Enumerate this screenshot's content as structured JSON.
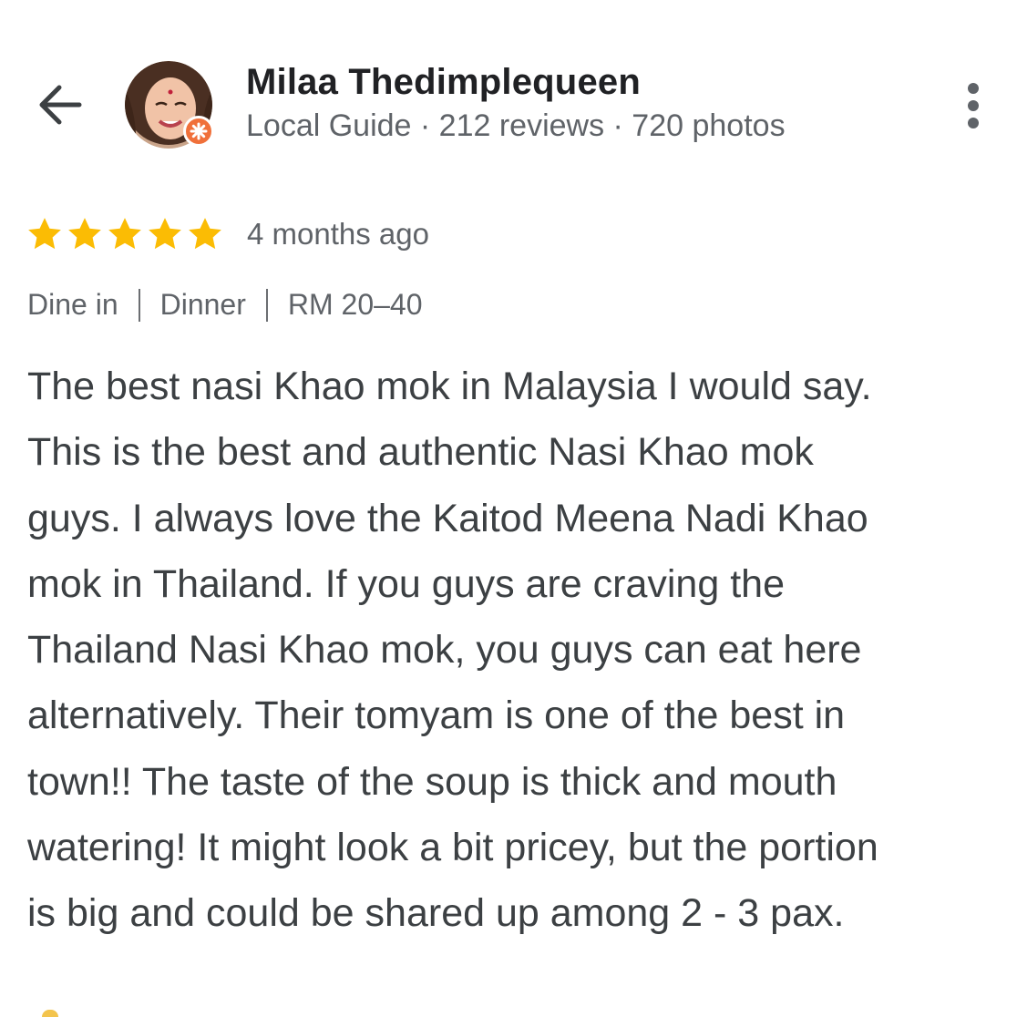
{
  "header": {
    "back_icon": "arrow-left-icon",
    "user_name": "Milaa Thedimplequeen",
    "user_meta": "Local Guide · 212 reviews · 720 photos",
    "avatar_icon": "user-avatar",
    "badge_icon": "local-guide-badge-icon",
    "more_icon": "more-vertical-icon"
  },
  "review": {
    "rating": 5,
    "rating_max": 5,
    "time_ago": "4 months ago",
    "attributes": [
      "Dine in",
      "Dinner",
      "RM 20–40"
    ],
    "text_lines": [
      "The best nasi Khao mok in Malaysia I would say.",
      "This is the best and authentic Nasi Khao mok",
      "guys. I always love the Kaitod Meena Nadi Khao",
      "mok in Thailand. If you guys are craving the",
      "Thailand Nasi Khao mok, you guys can eat here",
      "alternatively. Their tomyam is one of the best in",
      "town!! The taste of the soup is thick and mouth",
      "watering! It might look a bit pricey, but the portion",
      "is big and could be shared up among 2 - 3 pax."
    ]
  },
  "colors": {
    "star": "#FBBC04",
    "badge": "#F0703A",
    "primary_text": "#202124",
    "secondary_text": "#5F6368",
    "body_text": "#3C4043"
  }
}
